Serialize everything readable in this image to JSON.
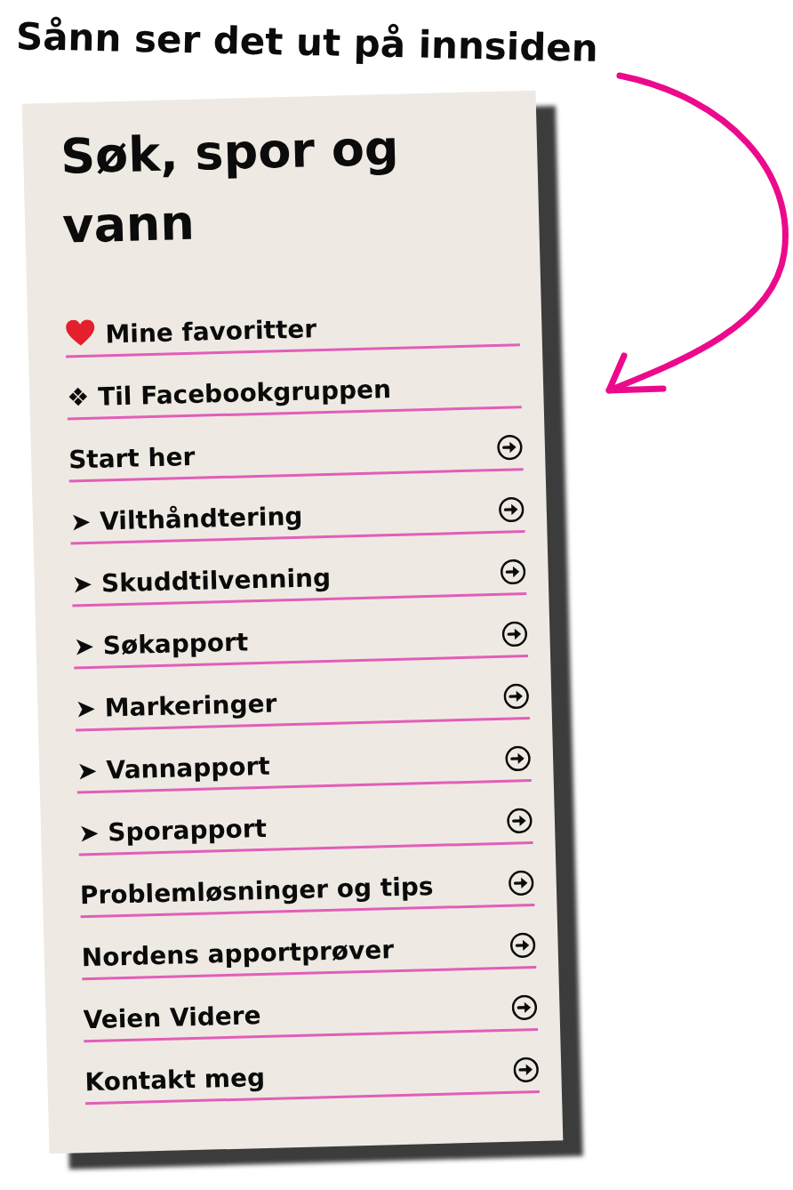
{
  "heading": "Sånn ser det ut på innsiden",
  "card": {
    "title": "Søk, spor og vann",
    "menu": [
      {
        "label": "Mine favoritter",
        "kind": "favorite"
      },
      {
        "label": "❖ Til Facebookgruppen",
        "kind": "link"
      },
      {
        "label": "Start her",
        "kind": "page"
      },
      {
        "label": "➤ Vilthåndtering",
        "kind": "page"
      },
      {
        "label": "➤ Skuddtilvenning",
        "kind": "page"
      },
      {
        "label": "➤ Søkapport",
        "kind": "page"
      },
      {
        "label": "➤ Markeringer",
        "kind": "page"
      },
      {
        "label": "➤ Vannapport",
        "kind": "page"
      },
      {
        "label": "➤ Sporapport",
        "kind": "page"
      },
      {
        "label": "Problemløsninger og tips",
        "kind": "page"
      },
      {
        "label": "Nordens apportprøver",
        "kind": "page"
      },
      {
        "label": "Veien Videre",
        "kind": "page"
      },
      {
        "label": "Kontakt meg",
        "kind": "page"
      }
    ]
  }
}
